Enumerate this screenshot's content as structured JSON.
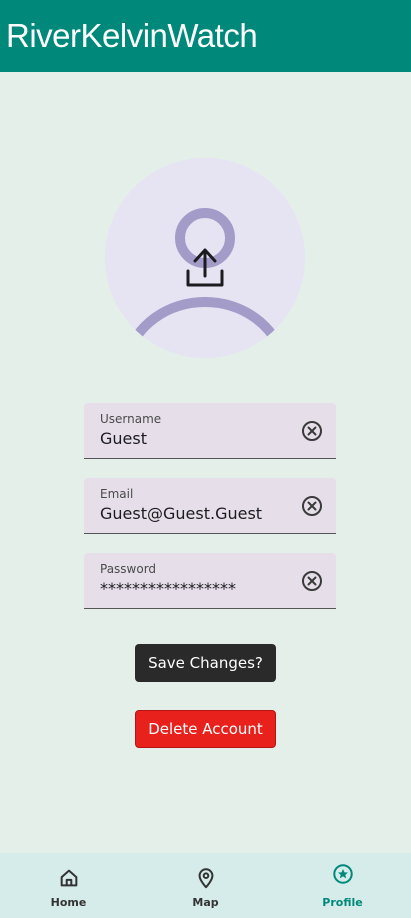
{
  "app": {
    "title": "RiverKelvinWatch"
  },
  "profile": {
    "avatar_icon": "upload-avatar-icon",
    "fields": [
      {
        "label": "Username",
        "value": "Guest"
      },
      {
        "label": "Email",
        "value": "Guest@Guest.Guest"
      },
      {
        "label": "Password",
        "value": "*****************"
      }
    ],
    "save_label": "Save Changes?",
    "delete_label": "Delete Account"
  },
  "nav": {
    "items": [
      {
        "label": "Home",
        "icon": "home-icon",
        "active": false
      },
      {
        "label": "Map",
        "icon": "map-pin-icon",
        "active": false
      },
      {
        "label": "Profile",
        "icon": "star-circle-icon",
        "active": true
      }
    ]
  },
  "colors": {
    "primary": "#00897b",
    "background": "#e4efe9",
    "delete": "#e8211d",
    "save": "#2a2a2a",
    "field_bg": "#e6dfea",
    "avatar_bg": "#e6e3f3",
    "avatar_fg": "#a39bc8"
  }
}
